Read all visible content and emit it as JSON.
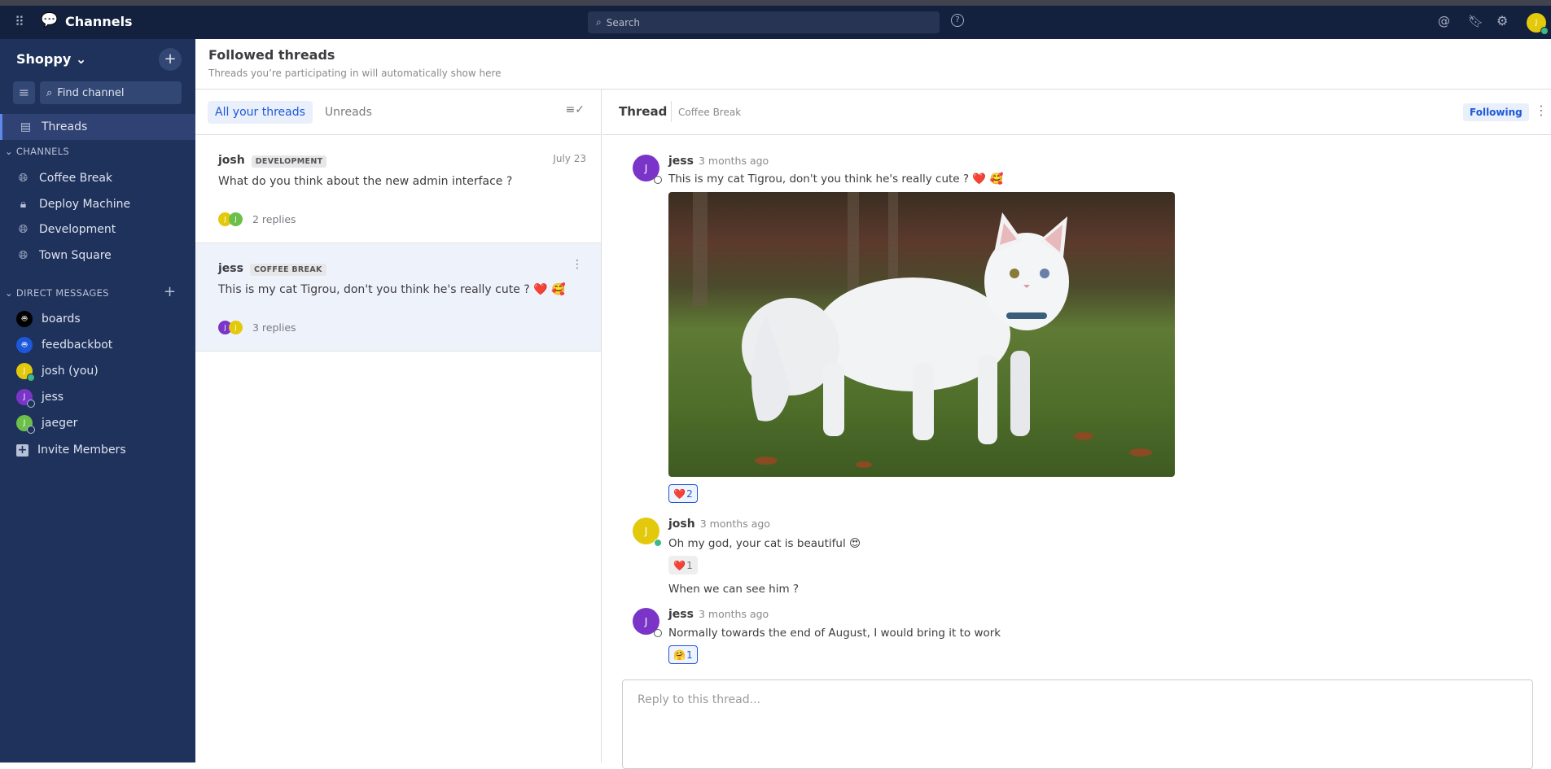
{
  "topbar": {
    "app_title": "Channels",
    "search_placeholder": "Search",
    "user_initial": "J"
  },
  "sidebar": {
    "team": "Shoppy",
    "find_channel": "Find channel",
    "threads_label": "Threads",
    "channels_header": "CHANNELS",
    "channels": [
      {
        "label": "Coffee Break",
        "icon": "globe-icon"
      },
      {
        "label": "Deploy Machine",
        "icon": "lock-icon"
      },
      {
        "label": "Development",
        "icon": "globe-icon"
      },
      {
        "label": "Town Square",
        "icon": "globe-icon"
      }
    ],
    "dm_header": "DIRECT MESSAGES",
    "dms": [
      {
        "label": "boards",
        "color": "#000000"
      },
      {
        "label": "feedbackbot",
        "color": "#1c58d9"
      },
      {
        "label": "josh (you)",
        "initial": "J",
        "color": "#e3c90c",
        "status": "online"
      },
      {
        "label": "jess",
        "initial": "J",
        "color": "#7a35c8",
        "status": "offline"
      },
      {
        "label": "jaeger",
        "initial": "J",
        "color": "#6cc04a",
        "status": "offline"
      }
    ],
    "invite": "Invite Members"
  },
  "followed": {
    "title": "Followed threads",
    "subtitle": "Threads you’re participating in will automatically show here"
  },
  "list": {
    "tabs": [
      "All your threads",
      "Unreads"
    ],
    "threads": [
      {
        "user": "josh",
        "channel": "DEVELOPMENT",
        "date": "July 23",
        "text": "What do you think about the new admin interface ?",
        "replies": "2 replies"
      },
      {
        "user": "jess",
        "channel": "COFFEE BREAK",
        "text": "This is my cat Tigrou, don't you think he's really cute ? ❤️ 🥰",
        "replies": "3 replies"
      }
    ]
  },
  "thread": {
    "title": "Thread",
    "channel": "Coffee Break",
    "follow_label": "Following",
    "messages": [
      {
        "user": "jess",
        "time": "3 months ago",
        "text": "This is my cat Tigrou, don't you think he's really cute ? ❤️ 🥰",
        "reaction": "❤️",
        "count": "2"
      },
      {
        "user": "josh",
        "time": "3 months ago",
        "text": "Oh my god, your cat is beautiful  😍",
        "reaction": "❤️",
        "count": "1",
        "followup": "When we can see him ?"
      },
      {
        "user": "jess",
        "time": "3 months ago",
        "text": "Normally towards the end of August, I would bring it to work",
        "reaction": "🤗",
        "count": "1"
      }
    ],
    "initial": "J",
    "reply_placeholder": "Reply to this thread..."
  },
  "colors": {
    "sidebar": "#1e325c",
    "header": "#14213e",
    "accent": "#1c58d9",
    "online": "#3db887"
  }
}
